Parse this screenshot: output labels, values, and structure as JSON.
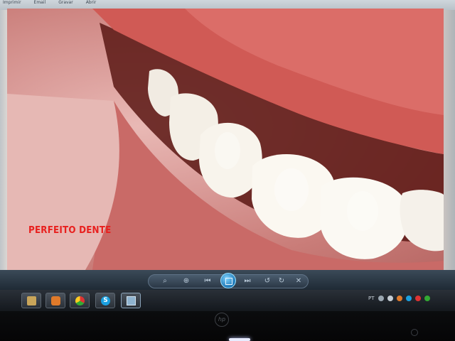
{
  "menu": {
    "items": [
      "Imprimir",
      "Email",
      "Gravar",
      "Abrir"
    ]
  },
  "image": {
    "caption": "PERFEITO DENTE"
  },
  "viewer": {
    "controls": [
      {
        "icon": "zoom-icon"
      },
      {
        "icon": "fit-icon"
      },
      {
        "icon": "previous-icon"
      },
      {
        "icon": "slideshow-icon"
      },
      {
        "icon": "next-icon"
      },
      {
        "icon": "rotate-left-icon"
      },
      {
        "icon": "rotate-right-icon"
      },
      {
        "icon": "delete-icon"
      }
    ]
  },
  "taskbar": {
    "apps": [
      {
        "icon": "folder-icon"
      },
      {
        "icon": "media-player-icon"
      },
      {
        "icon": "chrome-icon"
      },
      {
        "icon": "skype-icon"
      },
      {
        "icon": "photo-viewer-icon"
      }
    ],
    "tray": {
      "language": "PT"
    }
  },
  "colors": {
    "caption": "#e8201e",
    "accent": "#1f78b6"
  }
}
